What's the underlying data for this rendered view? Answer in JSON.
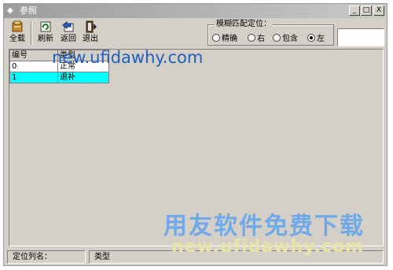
{
  "window": {
    "title": "参照",
    "buttons": [
      "_",
      "□",
      "X"
    ]
  },
  "toolbar": {
    "items": [
      {
        "label": "全载",
        "icon": "load-all-icon"
      },
      {
        "label": "刷新",
        "icon": "refresh-icon"
      },
      {
        "label": "返回",
        "icon": "return-icon"
      },
      {
        "label": "退出",
        "icon": "exit-icon"
      }
    ]
  },
  "match": {
    "legend": "模糊匹配定位：",
    "options": [
      {
        "label": "精确",
        "selected": false
      },
      {
        "label": "右",
        "selected": false
      },
      {
        "label": "包含",
        "selected": false
      },
      {
        "label": "左",
        "selected": true
      }
    ],
    "input_value": ""
  },
  "table": {
    "headers": [
      "编号",
      "类型"
    ],
    "rows": [
      {
        "cells": [
          "0",
          "正常"
        ],
        "selected": false
      },
      {
        "cells": [
          "1",
          "退补"
        ],
        "selected": true
      }
    ],
    "selected_color": "#00ffff"
  },
  "statusbar": {
    "label": "定位列名：",
    "value": "类型"
  },
  "watermark": {
    "url_top": "new.ufidawhy.com",
    "slogan": "用友软件免费下载",
    "url_bottom": "new.ufidawhy.com"
  }
}
